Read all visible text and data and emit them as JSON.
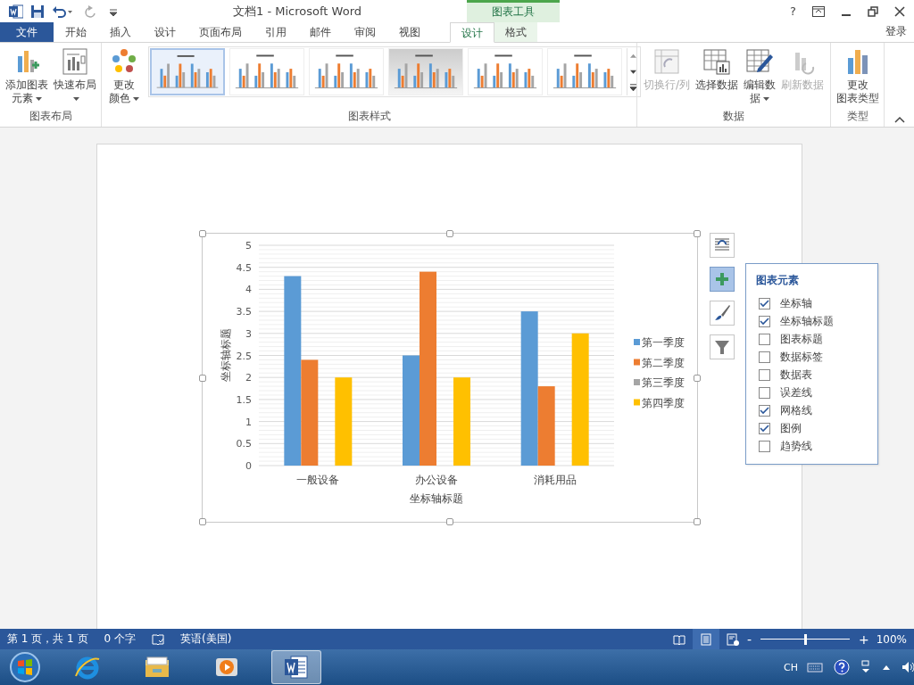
{
  "title_bar": {
    "title": "文档1 - Microsoft Word",
    "context_group": "图表工具",
    "help": "?"
  },
  "tabs": [
    {
      "label": "文件",
      "kind": "file",
      "selected": false
    },
    {
      "label": "开始",
      "kind": "normal",
      "selected": false
    },
    {
      "label": "插入",
      "kind": "normal",
      "selected": false
    },
    {
      "label": "设计",
      "kind": "normal",
      "selected": false
    },
    {
      "label": "页面布局",
      "kind": "normal",
      "selected": false
    },
    {
      "label": "引用",
      "kind": "normal",
      "selected": false
    },
    {
      "label": "邮件",
      "kind": "normal",
      "selected": false
    },
    {
      "label": "审阅",
      "kind": "normal",
      "selected": false
    },
    {
      "label": "视图",
      "kind": "normal",
      "selected": false
    },
    {
      "label": "设计",
      "kind": "context",
      "selected": true
    },
    {
      "label": "格式",
      "kind": "context",
      "selected": false
    }
  ],
  "account": "登录",
  "ribbon": {
    "groups": [
      {
        "label": "图表布局",
        "buttons": [
          {
            "kind": "add-element",
            "lines": [
              "添加图表",
              "元素"
            ],
            "dropdown": true,
            "disabled": false
          },
          {
            "kind": "quick-layout",
            "lines": [
              "快速布局"
            ],
            "dropdown": true,
            "disabled": false
          }
        ]
      },
      {
        "label": "图表样式",
        "buttons": [
          {
            "kind": "colors",
            "lines": [
              "更改",
              "颜色"
            ],
            "dropdown": true,
            "disabled": false
          }
        ],
        "styles": [
          {
            "selected": true
          },
          {
            "selected": false
          },
          {
            "selected": false
          },
          {
            "selected": false
          },
          {
            "selected": false
          },
          {
            "selected": false
          }
        ]
      },
      {
        "label": "数据",
        "buttons": [
          {
            "kind": "switch",
            "lines": [
              "切换行/列"
            ],
            "dropdown": false,
            "disabled": true
          },
          {
            "kind": "select-data",
            "lines": [
              "选择数据"
            ],
            "dropdown": false,
            "disabled": false
          },
          {
            "kind": "edit-data",
            "lines": [
              "编辑数",
              "据"
            ],
            "dropdown": true,
            "disabled": false
          },
          {
            "kind": "refresh",
            "lines": [
              "刷新数据"
            ],
            "dropdown": false,
            "disabled": true
          }
        ]
      },
      {
        "label": "类型",
        "buttons": [
          {
            "kind": "change-type",
            "lines": [
              "更改",
              "图表类型"
            ],
            "dropdown": false,
            "disabled": false
          }
        ]
      }
    ]
  },
  "chart": {
    "chart_data": {
      "type": "bar",
      "xlabel": "坐标轴标题",
      "ylabel": "坐标轴标题",
      "categories": [
        "一般设备",
        "办公设备",
        "消耗用品"
      ],
      "series": [
        {
          "name": "第一季度",
          "color": "#5b9bd5",
          "values": [
            4.3,
            2.5,
            3.5
          ]
        },
        {
          "name": "第二季度",
          "color": "#ed7d31",
          "values": [
            2.4,
            4.4,
            1.8
          ]
        },
        {
          "name": "第三季度",
          "color": "#a5a5a5",
          "values": [
            null,
            null,
            null
          ]
        },
        {
          "name": "第四季度",
          "color": "#ffc000",
          "values": [
            2,
            2,
            3
          ]
        }
      ],
      "grid": true,
      "legend": "right",
      "ylim": [
        0,
        5
      ],
      "yticks": [
        0,
        0.5,
        1,
        1.5,
        2,
        2.5,
        3,
        3.5,
        4,
        4.5,
        5
      ]
    }
  },
  "chart_buttons": [
    {
      "kind": "layout",
      "selected": false
    },
    {
      "kind": "elements",
      "selected": true
    },
    {
      "kind": "styles",
      "selected": false
    },
    {
      "kind": "filter",
      "selected": false
    }
  ],
  "elements_popup": {
    "title": "图表元素",
    "items": [
      {
        "label": "坐标轴",
        "checked": true
      },
      {
        "label": "坐标轴标题",
        "checked": true
      },
      {
        "label": "图表标题",
        "checked": false
      },
      {
        "label": "数据标签",
        "checked": false
      },
      {
        "label": "数据表",
        "checked": false
      },
      {
        "label": "误差线",
        "checked": false
      },
      {
        "label": "网格线",
        "checked": true
      },
      {
        "label": "图例",
        "checked": true
      },
      {
        "label": "趋势线",
        "checked": false
      }
    ]
  },
  "status_bar": {
    "page": "第 1 页，共 1 页",
    "words": "0 个字",
    "language": "英语(美国)",
    "views": [
      {
        "kind": "read",
        "selected": false
      },
      {
        "kind": "print",
        "selected": true
      },
      {
        "kind": "web",
        "selected": false
      }
    ],
    "zoom_minus": "-",
    "zoom_plus": "+",
    "zoom": {
      "level": 0.5
    },
    "zoom_text": "100%"
  },
  "taskbar": {
    "apps": [
      {
        "kind": "ie",
        "active": false
      },
      {
        "kind": "explorer",
        "active": false
      },
      {
        "kind": "media",
        "active": false
      },
      {
        "kind": "word",
        "active": true
      }
    ],
    "input_lang": "CH"
  }
}
